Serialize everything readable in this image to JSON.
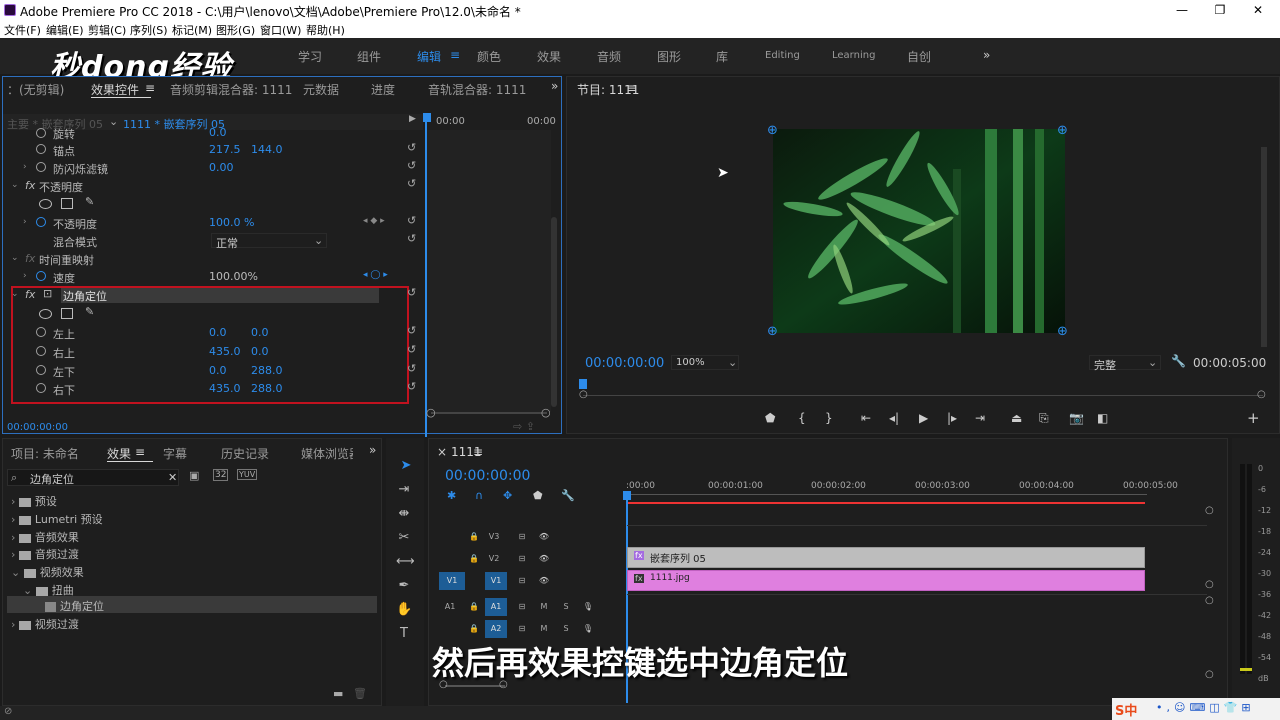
{
  "app": {
    "title": "Adobe Premiere Pro CC 2018 - C:\\用户\\lenovo\\文档\\Adobe\\Premiere Pro\\12.0\\未命名 *",
    "window_controls": [
      "—",
      "❐",
      "✕"
    ]
  },
  "menu": [
    "文件(F)",
    "编辑(E)",
    "剪辑(C)",
    "序列(S)",
    "标记(M)",
    "图形(G)",
    "窗口(W)",
    "帮助(H)"
  ],
  "workspaces": [
    "学习",
    "组件",
    "编辑",
    "颜色",
    "效果",
    "音频",
    "图形",
    "库",
    "Editing",
    "Learning",
    "自创"
  ],
  "workspace_active": "编辑",
  "watermark": "秒dong经验",
  "effect_controls": {
    "tabs": [
      "：(无剪辑)",
      "效果控件",
      "音频剪辑混合器: 1111",
      "元数据",
      "进度",
      "音轨混合器: 1111"
    ],
    "master_label": "主要 * 嵌套序列 05",
    "clip_label": "1111 * 嵌套序列 05",
    "time_start": "00:00",
    "time_end": "00:00",
    "rotate_label": "旋转",
    "rotate_value": "0.0",
    "anchor_label": "锚点",
    "anchor_x": "217.5",
    "anchor_y": "144.0",
    "flicker_label": "防闪烁滤镜",
    "flicker_value": "0.00",
    "opacity_group": "不透明度",
    "opacity_label": "不透明度",
    "opacity_value": "100.0 %",
    "blend_label": "混合模式",
    "blend_value": "正常",
    "time_remap": "时间重映射",
    "speed_label": "速度",
    "speed_value": "100.00%",
    "corner_pin": "边角定位",
    "upper_left_label": "左上",
    "upper_left_x": "0.0",
    "upper_left_y": "0.0",
    "upper_right_label": "右上",
    "upper_right_x": "435.0",
    "upper_right_y": "0.0",
    "lower_left_label": "左下",
    "lower_left_x": "0.0",
    "lower_left_y": "288.0",
    "lower_right_label": "右下",
    "lower_right_x": "435.0",
    "lower_right_y": "288.0",
    "timecode": "00:00:00:00",
    "fx": "fx"
  },
  "program_monitor": {
    "title": "节目: 1111",
    "timecode": "00:00:00:00",
    "zoom": "100%",
    "quality": "完整",
    "duration": "00:00:05:00"
  },
  "project": {
    "tabs": [
      "项目: 未命名",
      "效果",
      "字幕",
      "历史记录",
      "媒体浏览器"
    ],
    "search_value": "边角定位",
    "tree": [
      "预设",
      "Lumetri 预设",
      "音频效果",
      "音频过渡",
      "视频效果",
      "扭曲",
      "边角定位",
      "视频过渡"
    ],
    "preset_badges": [
      "32",
      "YUV"
    ]
  },
  "timeline": {
    "sequence": "1111",
    "timecode": "00:00:00:00",
    "ruler": [
      ":00:00",
      "00:00:01:00",
      "00:00:02:00",
      "00:00:03:00",
      "00:00:04:00",
      "00:00:05:00"
    ],
    "tracks": [
      "V3",
      "V2",
      "V1",
      "A1",
      "A2"
    ],
    "source_v1": "V1",
    "source_a1": "A1",
    "clip_nested": "嵌套序列 05",
    "clip_image": "1111.jpg",
    "mute_label": "M",
    "solo_label": "S"
  },
  "audio_meter": {
    "labels": [
      "0",
      "-6",
      "-12",
      "-18",
      "-24",
      "-30",
      "-36",
      "-42",
      "-48",
      "-54",
      "dB"
    ]
  },
  "subtitle": "然后再效果控键选中边角定位",
  "tray": "S中"
}
